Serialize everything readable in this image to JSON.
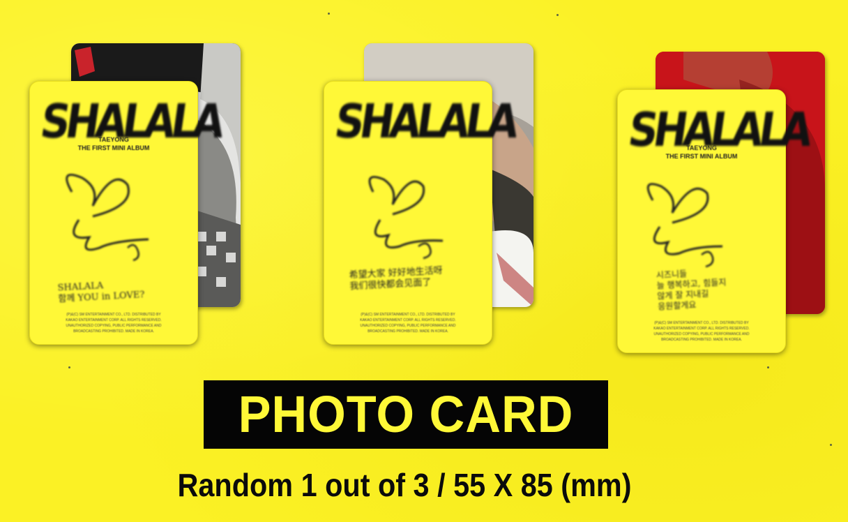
{
  "cards": [
    {
      "logo": "SHALALA",
      "artist": "TAEYONG",
      "album": "THE FIRST MINI ALBUM",
      "message": "SHALALA\n함께 YOU in LOVE?",
      "legal": "(P)&(C) SM ENTERTAINMENT CO., LTD. DISTRIBUTED BY\nKAKAO ENTERTAINMENT CORP. ALL RIGHTS RESERVED.\nUNAUTHORIZED COPYING, PUBLIC PERFORMANCE AND\nBROADCASTING PROHIBITED. MADE IN KOREA.",
      "back_color": "#d8d8d8"
    },
    {
      "logo": "SHALALA",
      "artist": "",
      "album": "",
      "message": "希望大家 好好地生活呀\n我们很快都会见面了",
      "legal": "(P)&(C) SM ENTERTAINMENT CO., LTD. DISTRIBUTED BY\nKAKAO ENTERTAINMENT CORP. ALL RIGHTS RESERVED.\nUNAUTHORIZED COPYING, PUBLIC PERFORMANCE AND\nBROADCASTING PROHIBITED. MADE IN KOREA.",
      "back_color": "#b8b2a6"
    },
    {
      "logo": "SHALALA",
      "artist": "TAEYONG",
      "album": "THE FIRST MINI ALBUM",
      "message": "시즈니들\n늘 행복하고, 힘들지\n않게 잘 지내길\n응원할게요",
      "legal": "(P)&(C) SM ENTERTAINMENT CO., LTD. DISTRIBUTED BY\nKAKAO ENTERTAINMENT CORP. ALL RIGHTS RESERVED.\nUNAUTHORIZED COPYING, PUBLIC PERFORMANCE AND\nBROADCASTING PROHIBITED. MADE IN KOREA.",
      "back_color": "#c8141a"
    }
  ],
  "title": "PHOTO CARD",
  "subtitle": "Random 1 out of 3 / 55 X 85 (mm)",
  "colors": {
    "background": "#fbf125",
    "card": "#fff837",
    "title_box": "#050505",
    "title_text": "#fff837"
  }
}
